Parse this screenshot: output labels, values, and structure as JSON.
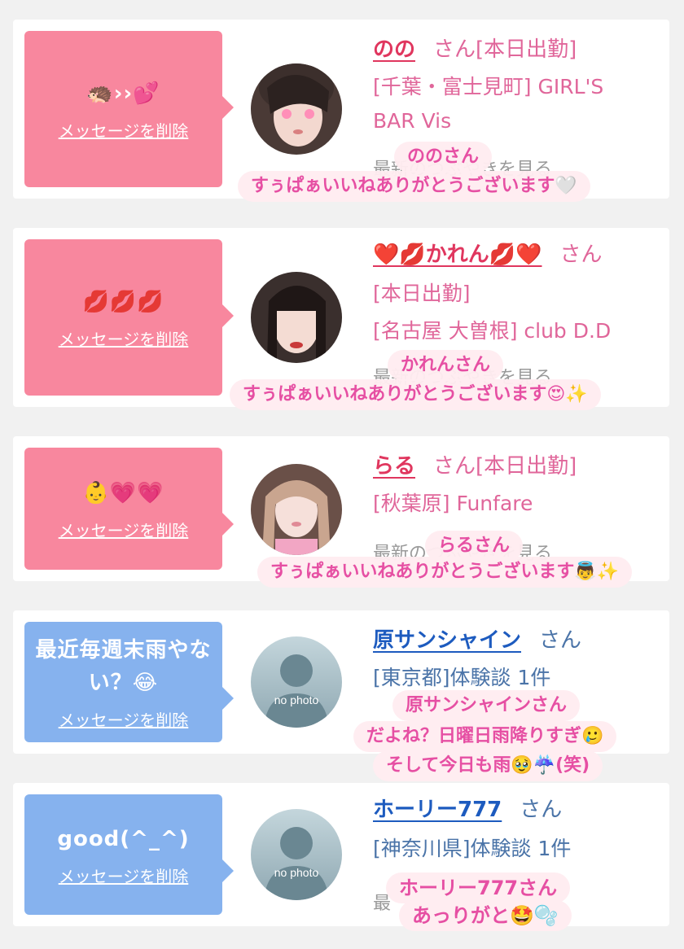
{
  "delete_label": "メッセージを削除",
  "recent_label": "最新のつぶやきを見る",
  "no_photo": "no photo",
  "colors": {
    "pink_bubble": "#f8879e",
    "blue_bubble": "#86b2ee",
    "pink_name": "#e0365e",
    "blue_name": "#1d5bbf",
    "overlay_text": "#e64fa3",
    "page_bg": "#f1f1f1"
  },
  "cards": [
    {
      "bubble_icons": [
        "hedgehog-icon",
        "growing-heart-icon"
      ],
      "bubble_text": "🦔››💕",
      "name": "のの",
      "san": "さん",
      "status": "[本日出勤]",
      "detail_1": "[千葉・富士見町] GIRL'S",
      "detail_2": "BAR Vis",
      "overlay_1": "ののさん",
      "overlay_2": "すぅぱぁいいねありがとうございます🤍"
    },
    {
      "bubble_icons": [
        "kiss-icon",
        "kiss-icon",
        "kiss-icon"
      ],
      "bubble_text": "💋💋💋",
      "name": "❤️💋かれん💋❤️",
      "san": "さん",
      "status": "[本日出勤]",
      "detail_1": "[名古屋 大曽根] club D.D",
      "overlay_1": "かれんさん",
      "overlay_2": "すぅぱぁいいねありがとうございます😍✨"
    },
    {
      "bubble_icons": [
        "baby-face-icon",
        "heart-icon",
        "heart-icon"
      ],
      "bubble_text": "👶💗💗",
      "name": "らる",
      "san": "さん",
      "status": "[本日出勤]",
      "detail_1": "[秋葉原] Funfare",
      "overlay_1": "らるさん",
      "overlay_2": "すぅぱぁいいねありがとうございます👼✨"
    },
    {
      "bubble_text": "最近毎週末雨やない？😂",
      "name": "原サンシャイン",
      "san": "さん",
      "detail_1": "[東京都]体験談 1件",
      "overlay_1": "原サンシャインさん",
      "overlay_2": "だよね？日曜日雨降りすぎ🥲",
      "overlay_3": "そして今日も雨🥹☔️(笑)"
    },
    {
      "bubble_text": "good(^_^)",
      "name": "ホーリー777",
      "san": "さん",
      "detail_1": "[神奈川県]体験談 1件",
      "overlay_1": "ホーリー777さん",
      "overlay_2": "あっりがと🤩🫧"
    }
  ]
}
